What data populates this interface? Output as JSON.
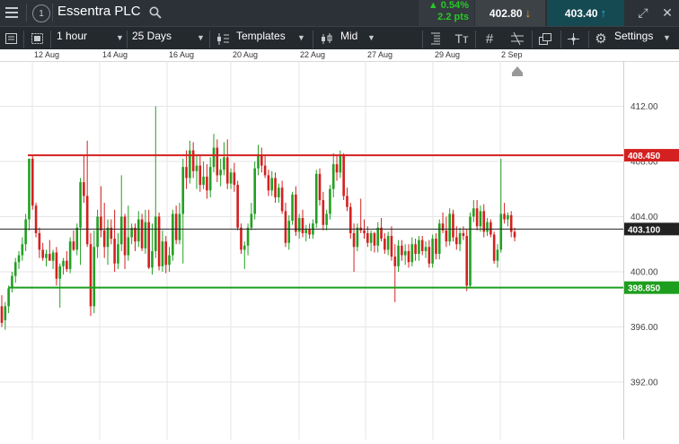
{
  "header": {
    "menu_icon": "hamburger-icon",
    "alert_count": "1",
    "title": "Essentra PLC",
    "change_pct": "0.54%",
    "change_pts": "2.2 pts",
    "sell_price": "402.80",
    "buy_price": "403.40"
  },
  "toolbar": {
    "interval": "1 hour",
    "range": "25 Days",
    "templates": "Templates",
    "price_type": "Mid",
    "settings": "Settings"
  },
  "dates": [
    "12 Aug",
    "14 Aug",
    "16 Aug",
    "20 Aug",
    "22 Aug",
    "27 Aug",
    "29 Aug",
    "2 Sep"
  ],
  "chart_data": {
    "type": "candlestick",
    "y_ticks": [
      "412.00",
      "408.00",
      "404.00",
      "400.00",
      "396.00",
      "392.00"
    ],
    "levels": [
      {
        "label": "408.450",
        "value": 408.45,
        "color": "#d42020"
      },
      {
        "label": "403.100",
        "value": 403.1,
        "color": "#222222"
      },
      {
        "label": "398.850",
        "value": 398.85,
        "color": "#1e9e1e"
      }
    ],
    "candles": [
      [
        397.5,
        398.3,
        396.0,
        396.3
      ],
      [
        396.5,
        397.8,
        395.8,
        397.5
      ],
      [
        397.5,
        399.0,
        397.0,
        398.8
      ],
      [
        398.8,
        400.0,
        398.5,
        399.7
      ],
      [
        399.7,
        401.0,
        399.2,
        400.7
      ],
      [
        400.7,
        401.5,
        400.2,
        401.2
      ],
      [
        401.2,
        402.5,
        400.8,
        402.0
      ],
      [
        402.0,
        404.2,
        401.5,
        403.8
      ],
      [
        403.8,
        408.2,
        403.0,
        408.2
      ],
      [
        408.2,
        408.4,
        404.5,
        404.8
      ],
      [
        404.8,
        405.0,
        402.5,
        402.8
      ],
      [
        402.8,
        403.2,
        401.0,
        401.6
      ],
      [
        401.6,
        402.1,
        400.8,
        401.0
      ],
      [
        401.0,
        401.6,
        400.4,
        401.3
      ],
      [
        401.3,
        402.3,
        400.9,
        400.8
      ],
      [
        400.8,
        401.6,
        400.2,
        401.4
      ],
      [
        401.4,
        401.8,
        399.0,
        399.5
      ],
      [
        399.5,
        400.6,
        397.4,
        400.4
      ],
      [
        400.4,
        401.0,
        399.8,
        400.8
      ],
      [
        400.8,
        401.5,
        400.0,
        400.2
      ],
      [
        400.2,
        402.5,
        399.9,
        402.2
      ],
      [
        402.2,
        403.0,
        401.5,
        401.6
      ],
      [
        401.6,
        403.5,
        401.2,
        403.2
      ],
      [
        403.2,
        406.8,
        400.5,
        406.5
      ],
      [
        406.5,
        408.5,
        405.0,
        405.5
      ],
      [
        405.5,
        409.5,
        401.8,
        402.0
      ],
      [
        402.0,
        402.8,
        396.8,
        397.5
      ],
      [
        397.5,
        403.0,
        397.0,
        401.8
      ],
      [
        401.8,
        404.5,
        401.0,
        404.0
      ],
      [
        404.0,
        406.2,
        402.5,
        403.0
      ],
      [
        403.0,
        405.0,
        401.0,
        401.8
      ],
      [
        401.8,
        403.8,
        400.5,
        403.2
      ],
      [
        403.2,
        403.8,
        402.0,
        402.4
      ],
      [
        402.4,
        404.5,
        400.0,
        400.6
      ],
      [
        400.6,
        402.8,
        400.2,
        402.0
      ],
      [
        402.0,
        407.0,
        401.5,
        404.0
      ],
      [
        404.0,
        404.2,
        400.2,
        401.2
      ],
      [
        401.2,
        404.8,
        400.8,
        402.5
      ],
      [
        402.5,
        403.5,
        402.0,
        403.2
      ],
      [
        403.2,
        403.5,
        401.5,
        402.2
      ],
      [
        402.2,
        404.4,
        401.8,
        403.8
      ],
      [
        403.8,
        404.2,
        401.5,
        401.7
      ],
      [
        401.7,
        404.5,
        401.3,
        403.6
      ],
      [
        403.6,
        404.5,
        400.2,
        400.3
      ],
      [
        400.3,
        403.5,
        399.8,
        401.5
      ],
      [
        401.5,
        412.0,
        401.0,
        404.0
      ],
      [
        404.0,
        404.3,
        400.1,
        400.4
      ],
      [
        400.4,
        403.0,
        400.0,
        402.2
      ],
      [
        402.2,
        402.6,
        399.9,
        400.5
      ],
      [
        400.5,
        401.8,
        400.0,
        401.2
      ],
      [
        401.2,
        404.5,
        400.8,
        404.2
      ],
      [
        404.2,
        404.8,
        402.0,
        402.3
      ],
      [
        402.3,
        405.0,
        402.0,
        404.2
      ],
      [
        404.2,
        408.2,
        400.6,
        407.6
      ],
      [
        407.6,
        408.8,
        406.0,
        406.8
      ],
      [
        406.8,
        409.5,
        406.4,
        408.8
      ],
      [
        408.8,
        409.4,
        406.8,
        407.3
      ],
      [
        407.3,
        408.4,
        406.0,
        407.7
      ],
      [
        407.7,
        408.5,
        405.8,
        406.3
      ],
      [
        406.3,
        408.0,
        406.0,
        406.9
      ],
      [
        406.9,
        407.8,
        405.3,
        405.9
      ],
      [
        405.9,
        408.3,
        405.4,
        407.6
      ],
      [
        407.6,
        410.0,
        407.2,
        409.0
      ],
      [
        409.0,
        409.6,
        406.5,
        407.0
      ],
      [
        407.0,
        408.2,
        406.2,
        407.4
      ],
      [
        407.4,
        409.4,
        407.0,
        408.3
      ],
      [
        408.3,
        409.6,
        406.0,
        406.4
      ],
      [
        406.4,
        407.5,
        406.0,
        407.2
      ],
      [
        407.2,
        407.9,
        405.8,
        406.3
      ],
      [
        406.3,
        406.6,
        403.0,
        403.2
      ],
      [
        403.2,
        403.5,
        401.3,
        401.6
      ],
      [
        401.6,
        402.2,
        400.2,
        401.9
      ],
      [
        401.9,
        403.5,
        401.2,
        403.2
      ],
      [
        403.2,
        405.0,
        403.0,
        404.2
      ],
      [
        404.2,
        408.0,
        403.8,
        407.5
      ],
      [
        407.5,
        409.2,
        407.0,
        408.5
      ],
      [
        408.5,
        409.0,
        407.2,
        407.7
      ],
      [
        407.7,
        408.4,
        406.8,
        407.0
      ],
      [
        407.0,
        407.4,
        405.5,
        405.9
      ],
      [
        405.9,
        407.3,
        405.5,
        406.8
      ],
      [
        406.8,
        407.2,
        405.0,
        405.4
      ],
      [
        405.4,
        406.4,
        405.0,
        406.1
      ],
      [
        406.1,
        406.6,
        404.2,
        404.4
      ],
      [
        404.4,
        405.0,
        401.8,
        402.1
      ],
      [
        402.1,
        404.1,
        401.6,
        403.7
      ],
      [
        403.7,
        405.8,
        403.4,
        405.6
      ],
      [
        405.6,
        406.2,
        402.6,
        402.9
      ],
      [
        402.9,
        404.2,
        402.4,
        403.9
      ],
      [
        403.9,
        404.5,
        402.5,
        402.8
      ],
      [
        402.8,
        403.4,
        402.2,
        403.1
      ],
      [
        403.1,
        403.5,
        402.4,
        402.7
      ],
      [
        402.7,
        403.8,
        402.4,
        403.5
      ],
      [
        403.5,
        407.4,
        403.2,
        407.1
      ],
      [
        407.1,
        407.5,
        404.8,
        405.2
      ],
      [
        405.2,
        405.8,
        403.0,
        403.4
      ],
      [
        403.4,
        404.5,
        403.0,
        404.2
      ],
      [
        404.2,
        406.3,
        403.8,
        406.0
      ],
      [
        406.0,
        408.6,
        405.4,
        407.8
      ],
      [
        407.8,
        408.5,
        406.6,
        407.2
      ],
      [
        407.2,
        408.8,
        406.8,
        408.4
      ],
      [
        408.4,
        408.6,
        405.2,
        405.5
      ],
      [
        405.5,
        406.1,
        404.4,
        404.7
      ],
      [
        404.7,
        405.0,
        402.4,
        402.8
      ],
      [
        402.8,
        403.5,
        400.0,
        401.8
      ],
      [
        401.8,
        403.5,
        401.5,
        403.2
      ],
      [
        403.2,
        405.3,
        402.8,
        403.0
      ],
      [
        403.0,
        403.8,
        402.4,
        402.8
      ],
      [
        402.8,
        403.3,
        401.8,
        402.1
      ],
      [
        402.1,
        403.0,
        401.5,
        402.8
      ],
      [
        402.8,
        402.9,
        401.4,
        401.9
      ],
      [
        401.9,
        403.6,
        401.4,
        403.2
      ],
      [
        403.2,
        403.9,
        402.2,
        402.4
      ],
      [
        402.4,
        402.8,
        401.3,
        401.6
      ],
      [
        401.6,
        402.9,
        401.2,
        402.6
      ],
      [
        402.6,
        403.3,
        400.8,
        401.1
      ],
      [
        401.1,
        402.0,
        397.8,
        400.4
      ],
      [
        400.4,
        402.3,
        400.0,
        401.9
      ],
      [
        401.9,
        402.3,
        400.8,
        401.2
      ],
      [
        401.2,
        402.0,
        400.5,
        401.5
      ],
      [
        401.5,
        402.0,
        400.3,
        400.7
      ],
      [
        400.7,
        402.5,
        400.4,
        402.0
      ],
      [
        402.0,
        402.4,
        400.8,
        401.3
      ],
      [
        401.3,
        402.6,
        400.8,
        402.3
      ],
      [
        402.3,
        402.6,
        401.2,
        401.5
      ],
      [
        401.5,
        402.2,
        401.0,
        401.8
      ],
      [
        401.8,
        402.3,
        400.3,
        400.6
      ],
      [
        400.6,
        402.7,
        400.3,
        402.4
      ],
      [
        402.4,
        402.8,
        400.9,
        401.3
      ],
      [
        401.3,
        403.8,
        400.9,
        403.5
      ],
      [
        403.5,
        404.3,
        402.8,
        403.0
      ],
      [
        403.0,
        404.0,
        401.8,
        402.2
      ],
      [
        402.2,
        404.6,
        401.9,
        404.2
      ],
      [
        404.2,
        404.5,
        402.2,
        402.5
      ],
      [
        402.5,
        403.3,
        401.6,
        402.0
      ],
      [
        402.0,
        403.2,
        401.5,
        402.8
      ],
      [
        402.8,
        403.3,
        402.3,
        402.6
      ],
      [
        402.6,
        403.1,
        398.6,
        399.0
      ],
      [
        399.0,
        404.3,
        398.8,
        404.0
      ],
      [
        404.0,
        405.2,
        403.6,
        404.6
      ],
      [
        404.6,
        405.2,
        403.0,
        403.3
      ],
      [
        403.3,
        404.8,
        402.9,
        404.4
      ],
      [
        404.4,
        404.9,
        402.5,
        402.9
      ],
      [
        402.9,
        403.9,
        402.6,
        403.6
      ],
      [
        403.6,
        403.8,
        402.5,
        402.7
      ],
      [
        402.7,
        402.9,
        400.6,
        400.8
      ],
      [
        400.8,
        402.0,
        400.3,
        401.6
      ],
      [
        401.6,
        408.2,
        401.4,
        404.2
      ],
      [
        404.2,
        405.0,
        403.5,
        403.8
      ],
      [
        403.8,
        404.3,
        403.3,
        404.1
      ],
      [
        404.1,
        404.4,
        402.5,
        402.9
      ],
      [
        402.9,
        403.2,
        402.2,
        402.5
      ]
    ]
  }
}
